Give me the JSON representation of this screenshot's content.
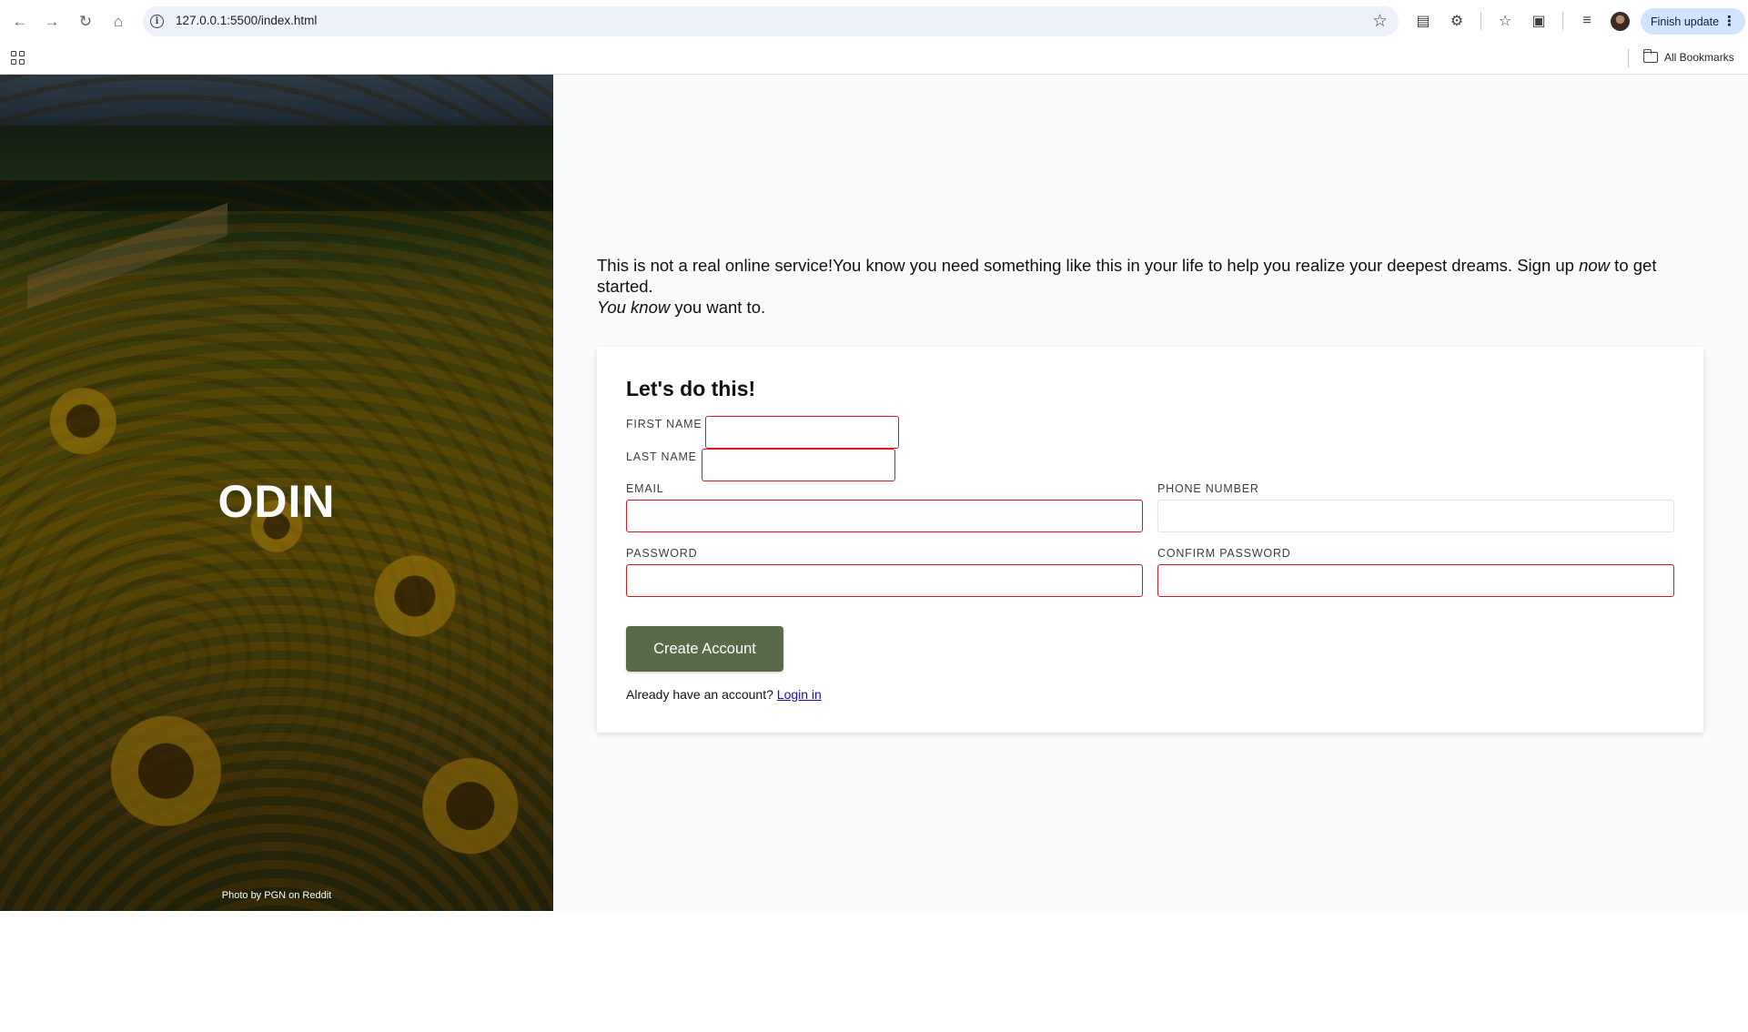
{
  "browser": {
    "url": "127.0.0.1:5500/index.html",
    "finish_update_label": "Finish update",
    "all_bookmarks_label": "All Bookmarks"
  },
  "hero": {
    "logo_text": "ODIN",
    "photo_credit": "Photo by PGN on Reddit"
  },
  "intro": {
    "line1_a": "This is not a real online service!You know you need something like this in your life to help you realize your deepest dreams. Sign up ",
    "line1_em": "now",
    "line1_b": " to get started.",
    "line2_em": "You know",
    "line2_b": " you want to."
  },
  "form": {
    "heading": "Let's do this!",
    "first_name_label": "FIRST NAME",
    "last_name_label": "LAST NAME",
    "email_label": "EMAIL",
    "phone_label": "PHONE NUMBER",
    "password_label": "PASSWORD",
    "confirm_password_label": "CONFIRM PASSWORD",
    "first_name_value": "",
    "last_name_value": "",
    "email_value": "",
    "phone_value": "",
    "password_value": "",
    "confirm_password_value": "",
    "submit_label": "Create Account",
    "login_prompt": "Already have an account? ",
    "login_link": "Login in"
  },
  "colors": {
    "button_bg": "#596a48",
    "invalid_border": "#e0141e",
    "page_bg": "#f9fafb",
    "link": "#1a0dab"
  },
  "icons": [
    "back-arrow-icon",
    "forward-arrow-icon",
    "reload-icon",
    "home-icon",
    "info-icon",
    "star-icon",
    "apps-icon",
    "folder-icon"
  ]
}
